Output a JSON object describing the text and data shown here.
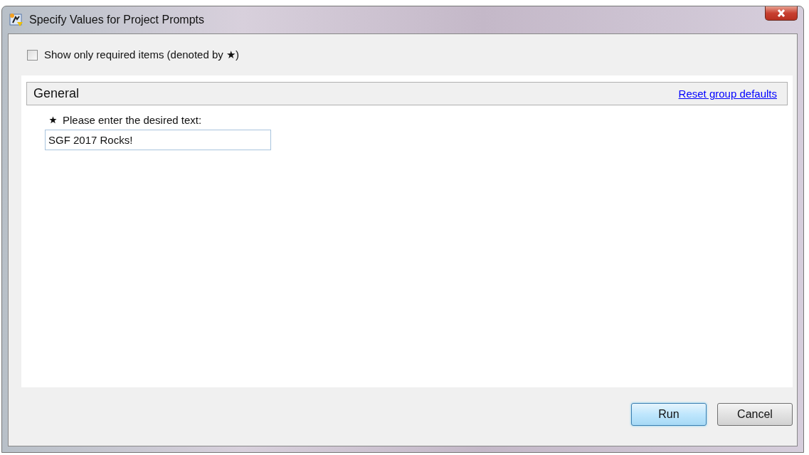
{
  "window": {
    "title": "Specify Values for Project Prompts"
  },
  "filter": {
    "label": "Show only required items (denoted by ★)",
    "checked": false
  },
  "group": {
    "title": "General",
    "link": "Reset group defaults"
  },
  "prompts": [
    {
      "label": "Please enter the desired text:",
      "required": true,
      "value": "SGF 2017 Rocks!"
    }
  ],
  "buttons": [
    {
      "label": "Run",
      "default": true
    },
    {
      "label": "Cancel",
      "default": false
    }
  ]
}
